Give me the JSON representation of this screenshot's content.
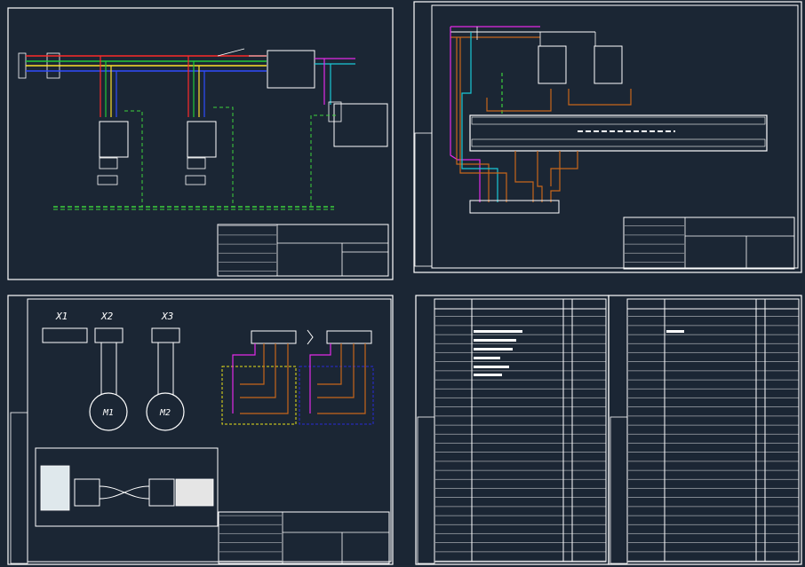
{
  "colors": {
    "background": "#1b2634",
    "frame": "#ffffff",
    "wire_red": "#ff2a2a",
    "wire_green": "#22c93a",
    "wire_yellow": "#ffe02a",
    "wire_blue": "#2f4cff",
    "wire_cyan": "#19c8d6",
    "wire_magenta": "#e22be8",
    "wire_orange": "#c8661a",
    "ground_green": "#3dd13d",
    "dash_yellow": "#e8e21a",
    "dash_blue": "#2a2ad8"
  },
  "sheet3": {
    "connector_x1": "X1",
    "connector_x2": "X2",
    "connector_x3": "X3",
    "motor_m1": "M1",
    "motor_m2": "M2"
  }
}
